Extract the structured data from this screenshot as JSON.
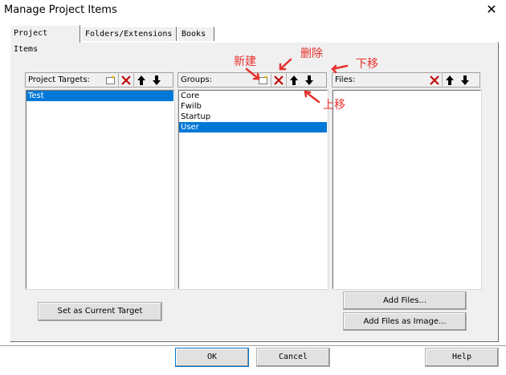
{
  "window": {
    "title": "Manage Project Items"
  },
  "tabs": [
    {
      "label": "Project Items",
      "active": true
    },
    {
      "label": "Folders/Extensions",
      "active": false
    },
    {
      "label": "Books",
      "active": false
    }
  ],
  "targets": {
    "header": "Project Targets:",
    "items": [
      "Test"
    ],
    "selected_index": 0
  },
  "groups": {
    "header": "Groups:",
    "items": [
      "Core",
      "Fwilb",
      "Startup",
      "User"
    ],
    "selected_index": 3
  },
  "files": {
    "header": "Files:",
    "items": []
  },
  "buttons": {
    "set_current_target": "Set as Current Target",
    "add_files": "Add Files...",
    "add_files_as_image": "Add Files as Image...",
    "ok": "OK",
    "cancel": "Cancel",
    "help": "Help"
  },
  "annotations": {
    "new": "新建",
    "delete": "删除",
    "move_down": "下移",
    "move_up": "上移"
  },
  "icons": {
    "new": "new-item-icon",
    "delete": "delete-icon",
    "move_up": "arrow-up-icon",
    "move_down": "arrow-down-icon",
    "close": "close-icon"
  },
  "colors": {
    "selection": "#0078d7",
    "delete_red": "#c00000",
    "annotation_red": "#e5322d",
    "dialog_bg": "#f0f0f0"
  }
}
